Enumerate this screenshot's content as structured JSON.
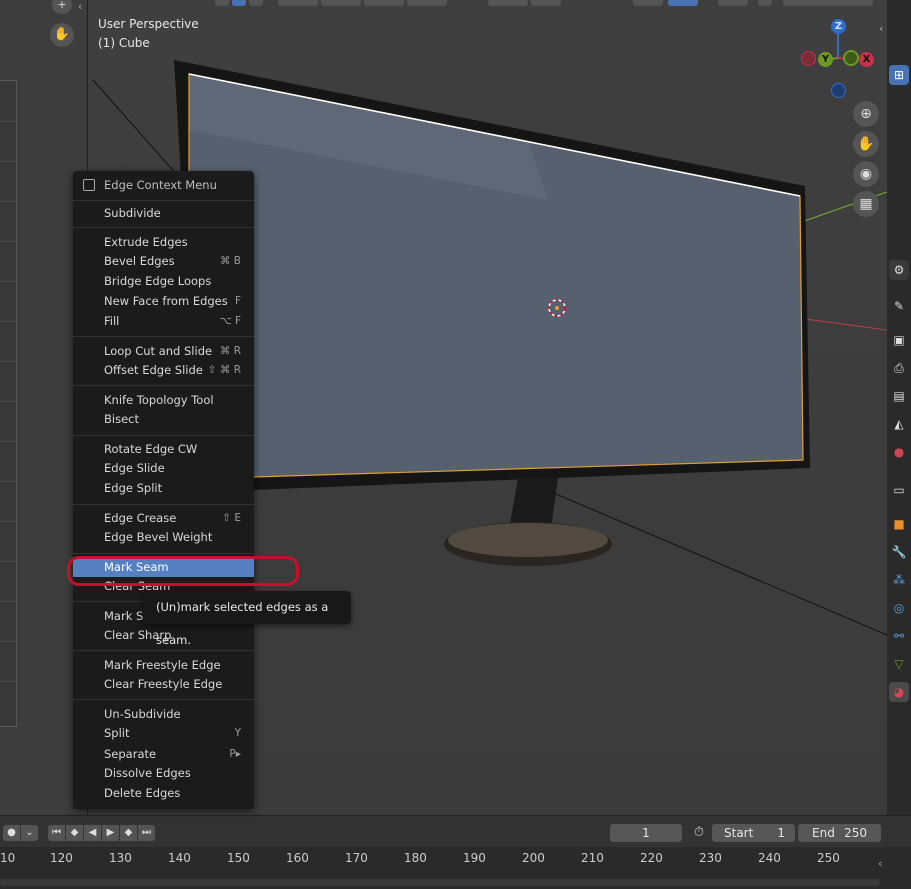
{
  "viewport": {
    "mode": "User Perspective",
    "object": "(1) Cube",
    "axes": {
      "z": "Z",
      "y": "Y",
      "x": "X"
    }
  },
  "context_menu": {
    "title": "Edge Context Menu",
    "items": [
      {
        "label": "Subdivide",
        "shortcut": ""
      },
      {
        "label": "Extrude Edges",
        "shortcut": ""
      },
      {
        "label": "Bevel Edges",
        "shortcut": "⌘ B"
      },
      {
        "label": "Bridge Edge Loops",
        "shortcut": ""
      },
      {
        "label": "New Face from Edges",
        "shortcut": "F"
      },
      {
        "label": "Fill",
        "shortcut": "⌥ F"
      },
      {
        "label": "Loop Cut and Slide",
        "shortcut": "⌘ R"
      },
      {
        "label": "Offset Edge Slide",
        "shortcut": "⇧ ⌘ R"
      },
      {
        "label": "Knife Topology Tool",
        "shortcut": ""
      },
      {
        "label": "Bisect",
        "shortcut": ""
      },
      {
        "label": "Rotate Edge CW",
        "shortcut": ""
      },
      {
        "label": "Edge Slide",
        "shortcut": ""
      },
      {
        "label": "Edge Split",
        "shortcut": ""
      },
      {
        "label": "Edge Crease",
        "shortcut": "⇧ E"
      },
      {
        "label": "Edge Bevel Weight",
        "shortcut": ""
      },
      {
        "label": "Mark Seam",
        "shortcut": ""
      },
      {
        "label": "Clear Seam",
        "shortcut": ""
      },
      {
        "label": "Mark Sharp",
        "shortcut": ""
      },
      {
        "label": "Clear Sharp",
        "shortcut": ""
      },
      {
        "label": "Mark Freestyle Edge",
        "shortcut": ""
      },
      {
        "label": "Clear Freestyle Edge",
        "shortcut": ""
      },
      {
        "label": "Un-Subdivide",
        "shortcut": ""
      },
      {
        "label": "Split",
        "shortcut": "Y"
      },
      {
        "label": "Separate",
        "shortcut": "P▸"
      },
      {
        "label": "Dissolve Edges",
        "shortcut": ""
      },
      {
        "label": "Delete Edges",
        "shortcut": ""
      }
    ],
    "active_item": "Mark Seam",
    "tooltip": "(Un)mark selected edges as a seam."
  },
  "timeline": {
    "current_frame": "1",
    "start_label": "Start",
    "start": "1",
    "end_label": "End",
    "end": "250",
    "ruler": [
      "10",
      "120",
      "130",
      "140",
      "150",
      "160",
      "170",
      "180",
      "190",
      "200",
      "210",
      "220",
      "230",
      "240",
      "250"
    ]
  },
  "colors": {
    "accent": "#5680c2",
    "highlight_ring": "#c8102e",
    "axis_x": "#c7324a",
    "axis_y": "#6c9a24",
    "axis_z": "#2f6ecf"
  },
  "icons": [
    "zoom-icon",
    "pan-hand-icon",
    "camera-icon",
    "grid-icon",
    "record-icon",
    "jump-start-icon",
    "prev-keyframe-icon",
    "play-reverse-icon",
    "play-icon",
    "next-keyframe-icon",
    "jump-end-icon",
    "stopwatch-icon"
  ]
}
